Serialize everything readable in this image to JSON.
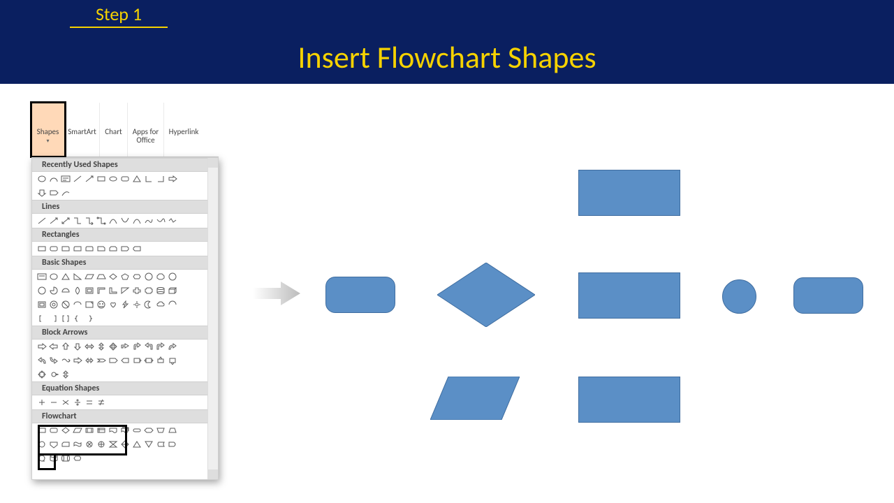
{
  "header": {
    "step_label": "Step 1",
    "title": "Insert Flowchart Shapes"
  },
  "ribbon": {
    "shapes": "Shapes",
    "smartart": "SmartArt",
    "chart": "Chart",
    "apps": "Apps for\nOffice",
    "hyperlink": "Hyperlink"
  },
  "categories": {
    "recent": "Recently Used Shapes",
    "lines": "Lines",
    "rects": "Rectangles",
    "basic": "Basic Shapes",
    "block": "Block Arrows",
    "eq": "Equation Shapes",
    "flow": "Flowchart"
  },
  "colors": {
    "header_bg": "#0a1f60",
    "accent": "#f6d200",
    "shape_fill": "#5b8fc6",
    "shape_stroke": "#3f6da0"
  }
}
